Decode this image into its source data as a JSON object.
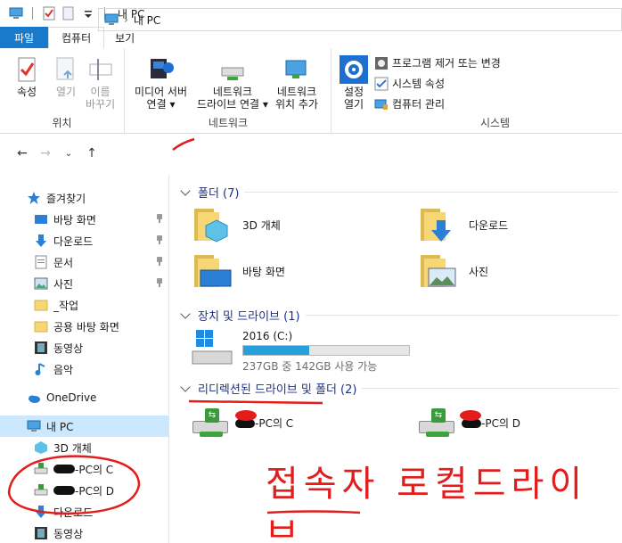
{
  "window": {
    "title": "내 PC"
  },
  "tabs": [
    {
      "label": "파일"
    },
    {
      "label": "컴퓨터"
    },
    {
      "label": "보기"
    }
  ],
  "ribbon": {
    "location": {
      "label": "위치",
      "properties": "속성",
      "open": "열기",
      "rename_line1": "이름",
      "rename_line2": "바꾸기"
    },
    "network": {
      "label": "네트워크",
      "media_line1": "미디어 서버",
      "media_line2": "연결",
      "map_line1": "네트워크",
      "map_line2": "드라이브 연결",
      "add_line1": "네트워크",
      "add_line2": "위치 추가"
    },
    "system": {
      "label": "시스템",
      "settings_line1": "설정",
      "settings_line2": "열기",
      "uninstall": "프로그램 제거 또는 변경",
      "sys_props": "시스템 속성",
      "manage": "컴퓨터 관리"
    }
  },
  "address": {
    "location": "내 PC"
  },
  "nav": {
    "quick_access": "즐겨찾기",
    "items": [
      {
        "label": "바탕 화면"
      },
      {
        "label": "다운로드"
      },
      {
        "label": "문서"
      },
      {
        "label": "사진"
      },
      {
        "label": "_작업"
      },
      {
        "label": "공용 바탕 화면"
      },
      {
        "label": "동영상"
      },
      {
        "label": "음악"
      }
    ],
    "onedrive": "OneDrive",
    "this_pc": "내 PC",
    "pc_items": [
      {
        "label": "3D 개체"
      },
      {
        "label": "-PC의 C"
      },
      {
        "label": "-PC의 D"
      },
      {
        "label": "다운로드"
      },
      {
        "label": "동영상"
      }
    ]
  },
  "content": {
    "folders_header": "폴더 (7)",
    "folders": [
      {
        "label": "3D 개체"
      },
      {
        "label": "다운로드"
      },
      {
        "label": "바탕 화면"
      },
      {
        "label": "사진"
      }
    ],
    "drives_header": "장치 및 드라이브 (1)",
    "drive": {
      "name": "2016 (C:)",
      "space": "237GB 중 142GB 사용 가능",
      "used_fraction": 0.4
    },
    "redirected_header": "리디렉션된 드라이브 및 폴더 (2)",
    "redirected": [
      {
        "label": "-PC의 C"
      },
      {
        "label": "-PC의 D"
      }
    ]
  },
  "annotation": {
    "text": "접속자 로컬드라이브",
    "color": "#e31c1c"
  }
}
